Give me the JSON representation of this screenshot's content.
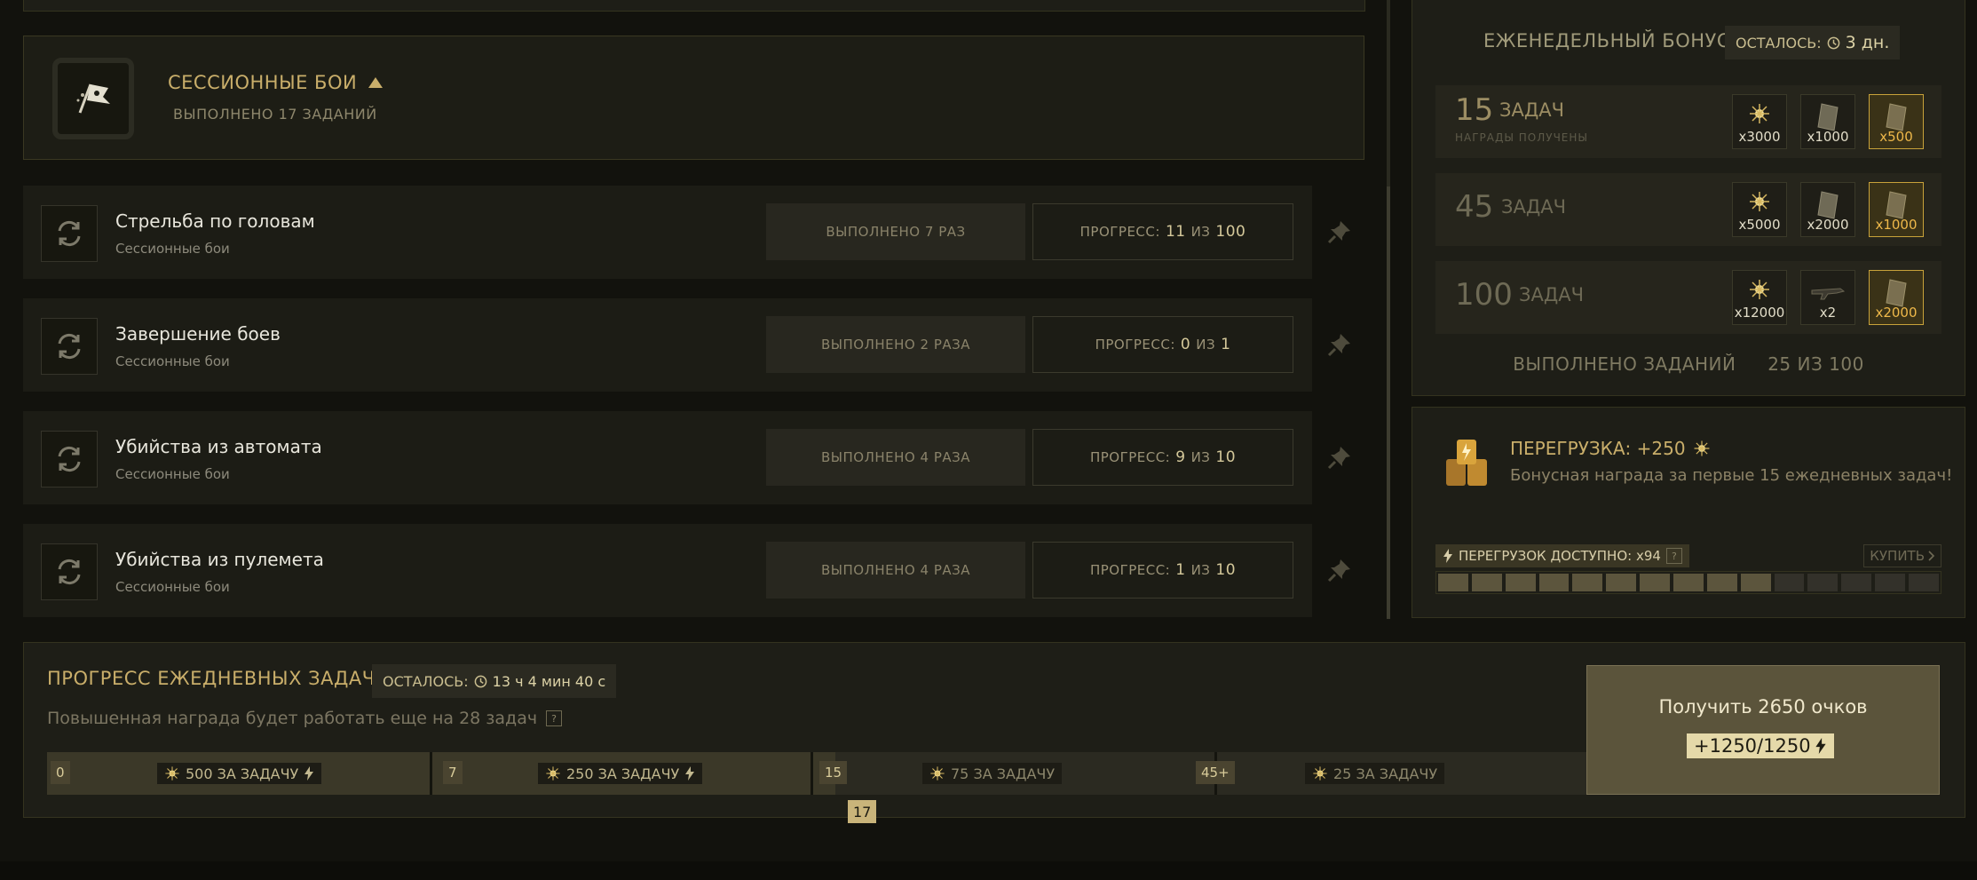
{
  "session": {
    "title": "СЕССИОННЫЕ БОИ",
    "completed": "ВЫПОЛНЕНО 17 ЗАДАНИЙ"
  },
  "tasks": [
    {
      "name": "Стрельба по головам",
      "category": "Сессионные бои",
      "done": "ВЫПОЛНЕНО 7 РАЗ",
      "progress_label": "ПРОГРЕСС:",
      "current": "11",
      "of": "ИЗ",
      "total": "100"
    },
    {
      "name": "Завершение боев",
      "category": "Сессионные бои",
      "done": "ВЫПОЛНЕНО 2 РАЗА",
      "progress_label": "ПРОГРЕСС:",
      "current": "0",
      "of": "ИЗ",
      "total": "1"
    },
    {
      "name": "Убийства из автомата",
      "category": "Сессионные бои",
      "done": "ВЫПОЛНЕНО 4 РАЗА",
      "progress_label": "ПРОГРЕСС:",
      "current": "9",
      "of": "ИЗ",
      "total": "10"
    },
    {
      "name": "Убийства из пулемета",
      "category": "Сессионные бои",
      "done": "ВЫПОЛНЕНО 4 РАЗА",
      "progress_label": "ПРОГРЕСС:",
      "current": "1",
      "of": "ИЗ",
      "total": "10"
    }
  ],
  "weekly": {
    "title": "ЕЖЕНЕДЕЛЬНЫЙ БОНУС",
    "left_label": "ОСТАЛОСЬ:",
    "left_value": "3 дн.",
    "tiers": [
      {
        "num": "15",
        "word": "ЗАДАЧ",
        "sub": "НАГРАДЫ ПОЛУЧЕНЫ",
        "rewards": [
          "x3000",
          "x1000",
          "x500"
        ]
      },
      {
        "num": "45",
        "word": "ЗАДАЧ",
        "sub": "",
        "rewards": [
          "x5000",
          "x2000",
          "x1000"
        ]
      },
      {
        "num": "100",
        "word": "ЗАДАЧ",
        "sub": "",
        "rewards": [
          "x12000",
          "x2",
          "x2000"
        ]
      }
    ],
    "done_label": "ВЫПОЛНЕНО ЗАДАНИЙ",
    "done_value": "25 ИЗ 100"
  },
  "overload": {
    "title": "ПЕРЕГРУЗКА: +250",
    "desc": "Бонусная награда за первые 15 ежедневных задач!",
    "available": "ПЕРЕГРУЗОК ДОСТУПНО: x94",
    "help": "?",
    "buy": "КУПИТЬ",
    "bar_total": 15,
    "bar_filled": 10
  },
  "daily": {
    "title": "ПРОГРЕСС ЕЖЕДНЕВНЫХ ЗАДАЧ",
    "left_label": "ОСТАЛОСЬ:",
    "left_value": "13 ч 4 мин 40 с",
    "note": "Повышенная награда будет работать еще на 28 задач",
    "help": "?",
    "segments": [
      {
        "marker": "0",
        "label": "500 ЗА ЗАДАЧУ"
      },
      {
        "marker": "7",
        "label": "250 ЗА ЗАДАЧУ"
      },
      {
        "marker": "15",
        "label": "75 ЗА ЗАДАЧУ"
      },
      {
        "marker": "45+",
        "label": "25 ЗА ЗАДАЧУ"
      }
    ],
    "current": "17"
  },
  "claim": {
    "title": "Получить 2650 очков",
    "points": "+1250/1250"
  },
  "colors": {
    "accent": "#c9ae6a",
    "highlight": "#c8a23a"
  }
}
